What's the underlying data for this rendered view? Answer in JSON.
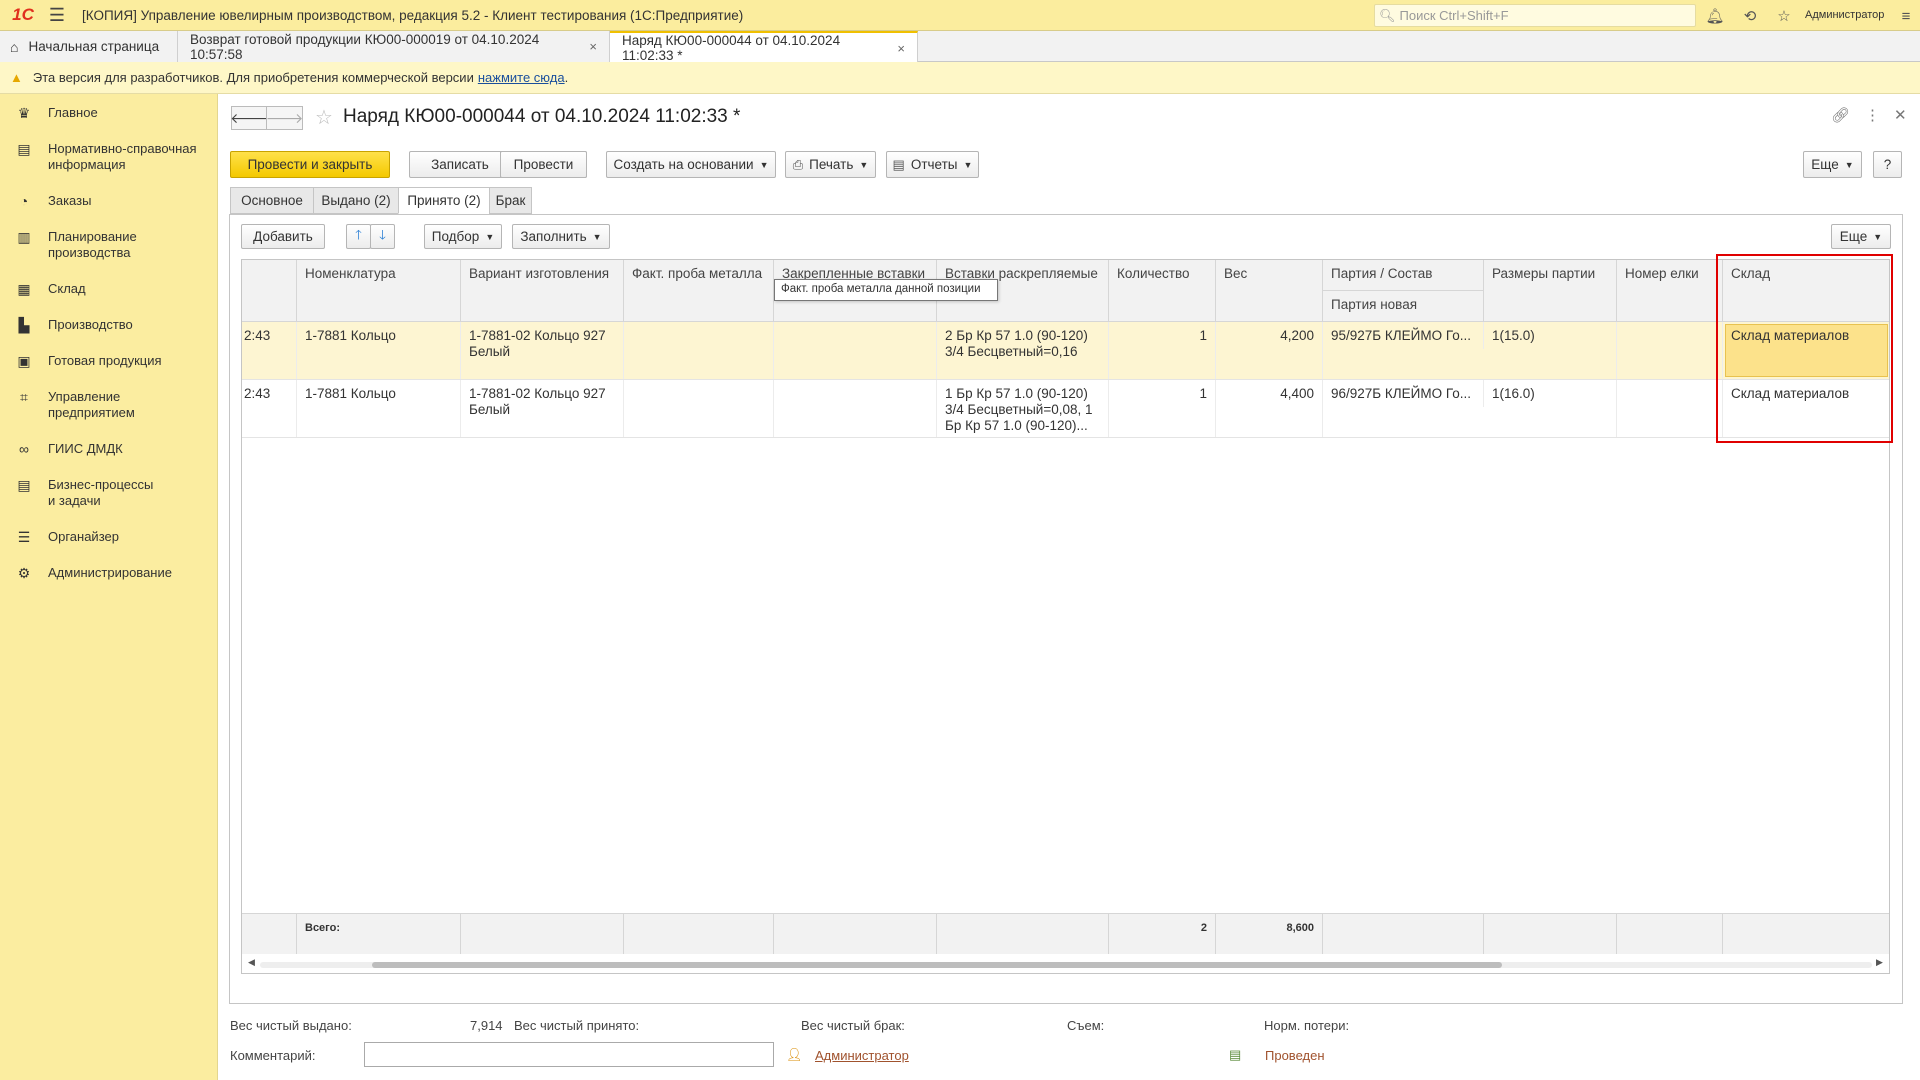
{
  "app": {
    "logo": "1С",
    "title": "[КОПИЯ] Управление ювелирным производством, редакция 5.2  - Клиент тестирования (1С:Предприятие)",
    "search_placeholder": "Поиск Ctrl+Shift+F",
    "user": "Администратор"
  },
  "tabs": [
    {
      "label": "Начальная страница"
    },
    {
      "label": "Возврат готовой продукции КЮ00-000019 от 04.10.2024 10:57:58"
    },
    {
      "label": "Наряд КЮ00-000044 от 04.10.2024 11:02:33 *"
    }
  ],
  "warning": {
    "text": "Эта версия для разработчиков. Для приобретения коммерческой версии",
    "link": "нажмите сюда",
    "after": "."
  },
  "sidebar": {
    "items": [
      {
        "label": "Главное",
        "icon": "crown-icon"
      },
      {
        "label": "Нормативно-справочная информация",
        "icon": "book-icon"
      },
      {
        "label": "Заказы",
        "icon": "pie-icon"
      },
      {
        "label": "Планирование производства",
        "icon": "clipboard-icon"
      },
      {
        "label": "Склад",
        "icon": "grid-icon"
      },
      {
        "label": "Производство",
        "icon": "factory-icon"
      },
      {
        "label": "Готовая продукция",
        "icon": "bag-icon"
      },
      {
        "label": "Управление предприятием",
        "icon": "chart-icon"
      },
      {
        "label": "ГИИС ДМДК",
        "icon": "link-icon"
      },
      {
        "label": "Бизнес-процессы и задачи",
        "icon": "tasks-icon"
      },
      {
        "label": "Органайзер",
        "icon": "organizer-icon"
      },
      {
        "label": "Администрирование",
        "icon": "gear-icon"
      }
    ]
  },
  "document": {
    "title": "Наряд КЮ00-000044 от 04.10.2024 11:02:33 *"
  },
  "toolbar": {
    "post_close": "Провести и закрыть",
    "save": "Записать",
    "post": "Провести",
    "create_based": "Создать на основании",
    "print": "Печать",
    "reports": "Отчеты",
    "more": "Еще",
    "help": "?"
  },
  "form_tabs": [
    {
      "label": "Основное"
    },
    {
      "label": "Выдано (2)"
    },
    {
      "label": "Принято (2)"
    },
    {
      "label": "Брак"
    }
  ],
  "table_toolbar": {
    "add": "Добавить",
    "pick": "Подбор",
    "fill": "Заполнить",
    "more": "Еще"
  },
  "table": {
    "columns": {
      "nomenclature": "Номенклатура",
      "variant": "Вариант изготовления",
      "probe": "Факт. проба металла",
      "fixed_inserts": "Закрепленные вставки",
      "loose_inserts": "Вставки раскрепляемые",
      "qty": "Количество",
      "weight": "Вес",
      "batch": "Партия / Состав",
      "batch_new": "Партия новая",
      "batch_sizes": "Размеры партии",
      "tree_no": "Номер елки",
      "warehouse": "Склад"
    },
    "rows": [
      {
        "time": "2:43",
        "nomenclature": "1-7881 Кольцо",
        "variant_l1": "1-7881-02 Кольцо 927",
        "variant_l2": "Белый",
        "loose_l1": "2 Бр Кр 57 1.0 (90-120)",
        "loose_l2": "3/4 Бесцветный=0,16",
        "loose_l3": "",
        "qty": "1",
        "weight": "4,200",
        "batch": "95/927Б КЛЕЙМО Го...",
        "sizes": "1(15.0)",
        "warehouse": "Склад материалов"
      },
      {
        "time": "2:43",
        "nomenclature": "1-7881 Кольцо",
        "variant_l1": "1-7881-02 Кольцо 927",
        "variant_l2": "Белый",
        "loose_l1": "1 Бр Кр 57 1.0 (90-120)",
        "loose_l2": "3/4 Бесцветный=0,08, 1",
        "loose_l3": "Бр Кр 57 1.0 (90-120)...",
        "qty": "1",
        "weight": "4,400",
        "batch": "96/927Б КЛЕЙМО Го...",
        "sizes": "1(16.0)",
        "warehouse": "Склад материалов"
      }
    ],
    "totals": {
      "label": "Всего:",
      "qty": "2",
      "weight": "8,600"
    }
  },
  "tooltip": "Факт. проба металла данной позиции",
  "bottom": {
    "net_issued_label": "Вес чистый выдано:",
    "net_issued_value": "7,914",
    "net_accepted_label": "Вес чистый принято:",
    "net_defect_label": "Вес чистый брак:",
    "removal_label": "Съем:",
    "norm_loss_label": "Норм. потери:",
    "comment_label": "Комментарий:",
    "author": "Администратор",
    "status": "Проведен"
  },
  "colors": {
    "sidebar_bg": "#fbeda0",
    "primary_button": "#f4c900",
    "highlight_frame": "#e00000"
  }
}
